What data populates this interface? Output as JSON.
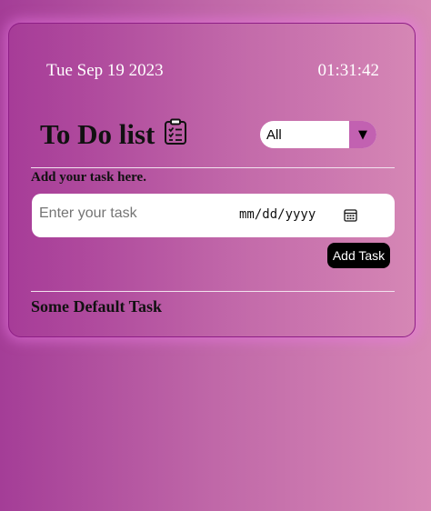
{
  "header": {
    "date": "Tue Sep 19 2023",
    "time": "01:31:42"
  },
  "title": {
    "text": "To Do list",
    "icon": "clipboard-list-icon"
  },
  "filter": {
    "selected": "All",
    "arrow_icon": "dropdown-arrow-icon"
  },
  "form": {
    "label": "Add your task here.",
    "task_placeholder": "Enter your task",
    "date_placeholder": "mm/dd/yyyy",
    "calendar_icon": "calendar-icon",
    "add_button": "Add Task"
  },
  "tasks": [
    {
      "text": "Some Default Task"
    }
  ],
  "colors": {
    "background_start": "#a43d97",
    "background_end": "#d789b6",
    "card_border": "#8e1f86",
    "dropdown_accent": "#c261b1",
    "button": "#000000"
  }
}
